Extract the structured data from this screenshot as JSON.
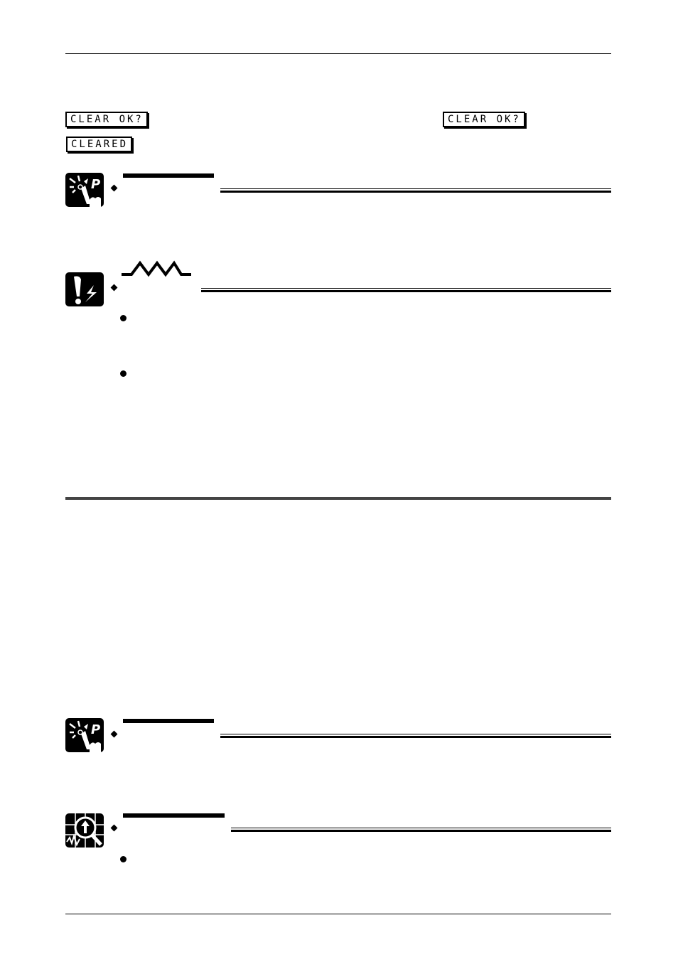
{
  "page": {
    "header_rule": true,
    "footer_rule": true
  },
  "lcd_displays": [
    {
      "id": "clear-ok-1",
      "text": "CLEAR OK?"
    },
    {
      "id": "cleared",
      "text": "CLEARED"
    },
    {
      "id": "clear-ok-2",
      "text": "CLEAR OK?"
    }
  ],
  "sections": [
    {
      "type": "point",
      "icon": "point-hand-icon",
      "bullets": 0
    },
    {
      "type": "caution",
      "icon": "caution-icon",
      "bullets": 2
    },
    {
      "type": "point",
      "icon": "point-hand-icon",
      "bullets": 0
    },
    {
      "type": "reference",
      "icon": "magnifier-graph-icon",
      "bullets": 1
    }
  ]
}
